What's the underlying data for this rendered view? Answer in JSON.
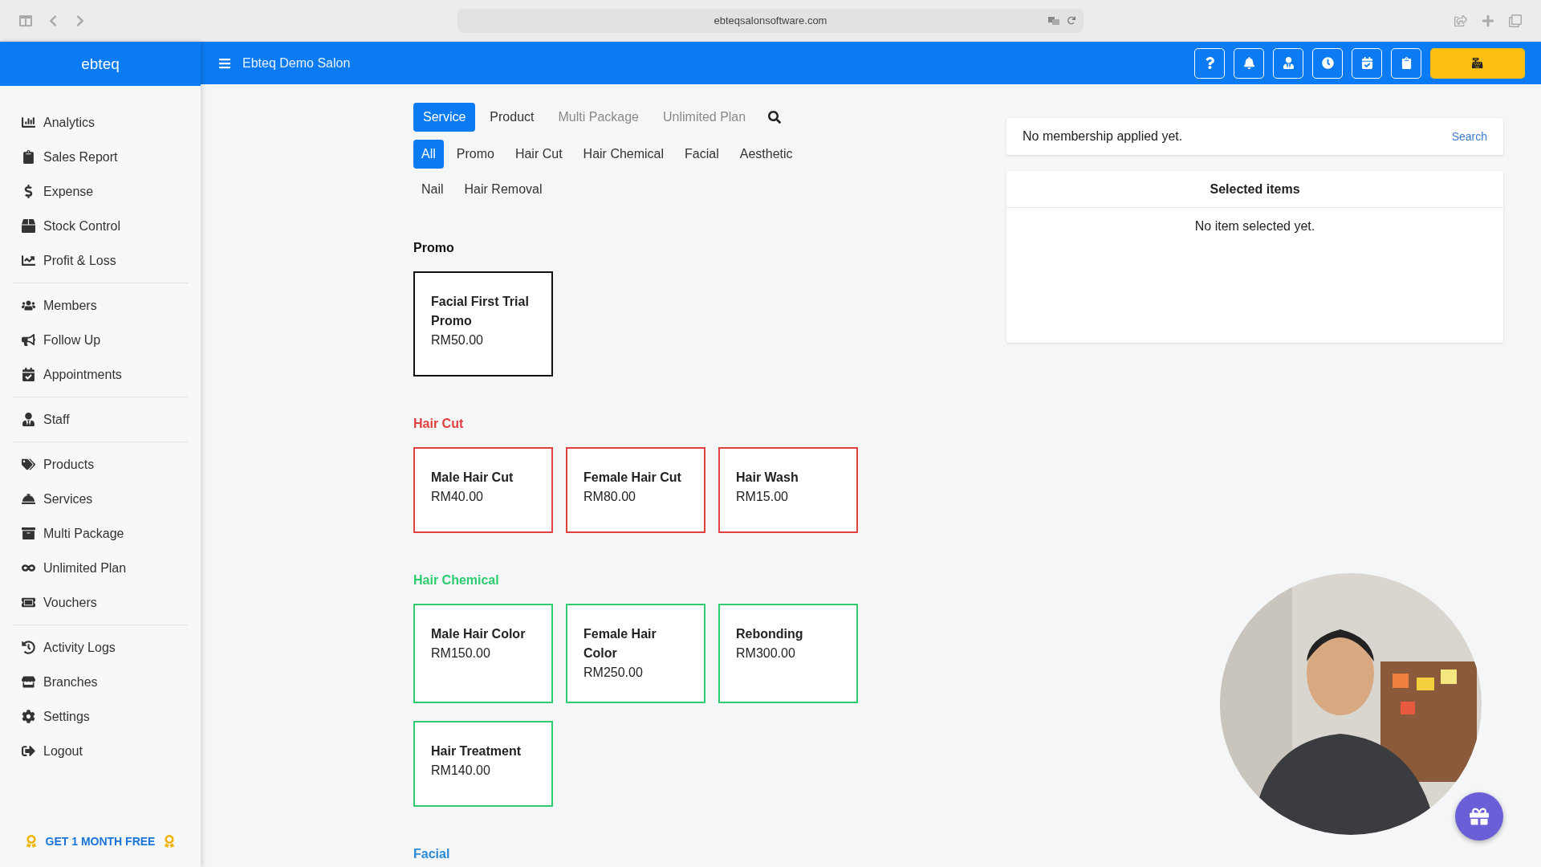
{
  "browser": {
    "url": "ebteqsalonsoftware.com"
  },
  "sidebar": {
    "brand": "ebteq",
    "groups": [
      {
        "items": [
          {
            "label": "Analytics"
          },
          {
            "label": "Sales Report"
          },
          {
            "label": "Expense"
          },
          {
            "label": "Stock Control"
          },
          {
            "label": "Profit & Loss"
          }
        ]
      },
      {
        "items": [
          {
            "label": "Members"
          },
          {
            "label": "Follow Up"
          },
          {
            "label": "Appointments"
          }
        ]
      },
      {
        "items": [
          {
            "label": "Staff"
          }
        ]
      },
      {
        "items": [
          {
            "label": "Products"
          },
          {
            "label": "Services"
          },
          {
            "label": "Multi Package"
          },
          {
            "label": "Unlimited Plan"
          },
          {
            "label": "Vouchers"
          }
        ]
      },
      {
        "items": [
          {
            "label": "Activity Logs"
          },
          {
            "label": "Branches"
          },
          {
            "label": "Settings"
          },
          {
            "label": "Logout"
          }
        ]
      }
    ],
    "promo": "GET 1 MONTH FREE"
  },
  "header": {
    "title": "Ebteq Demo Salon"
  },
  "tabs": [
    {
      "label": "Service",
      "selected": true,
      "disabled": false
    },
    {
      "label": "Product",
      "selected": false,
      "disabled": false
    },
    {
      "label": "Multi Package",
      "selected": false,
      "disabled": true
    },
    {
      "label": "Unlimited Plan",
      "selected": false,
      "disabled": true
    }
  ],
  "categories": [
    {
      "label": "All",
      "selected": true
    },
    {
      "label": "Promo",
      "selected": false
    },
    {
      "label": "Hair Cut",
      "selected": false
    },
    {
      "label": "Hair Chemical",
      "selected": false
    },
    {
      "label": "Facial",
      "selected": false
    },
    {
      "label": "Aesthetic",
      "selected": false
    },
    {
      "label": "Nail",
      "selected": false
    },
    {
      "label": "Hair Removal",
      "selected": false
    }
  ],
  "sections": [
    {
      "title": "Promo",
      "color": "#111111",
      "items": [
        {
          "name": "Facial First Trial Promo",
          "price": "RM50.00"
        }
      ]
    },
    {
      "title": "Hair Cut",
      "color": "#e0413f",
      "items": [
        {
          "name": "Male Hair Cut",
          "price": "RM40.00"
        },
        {
          "name": "Female Hair Cut",
          "price": "RM80.00"
        },
        {
          "name": "Hair Wash",
          "price": "RM15.00"
        }
      ]
    },
    {
      "title": "Hair Chemical",
      "color": "#2ecc71",
      "items": [
        {
          "name": "Male Hair Color",
          "price": "RM150.00"
        },
        {
          "name": "Female Hair Color",
          "price": "RM250.00"
        },
        {
          "name": "Rebonding",
          "price": "RM300.00"
        },
        {
          "name": "Hair Treatment",
          "price": "RM140.00"
        }
      ]
    },
    {
      "title": "Facial",
      "color": "#2a8ad8"
    }
  ],
  "membership": {
    "text": "No membership applied yet.",
    "link": "Search"
  },
  "selected_items": {
    "title": "Selected items",
    "empty": "No item selected yet."
  }
}
